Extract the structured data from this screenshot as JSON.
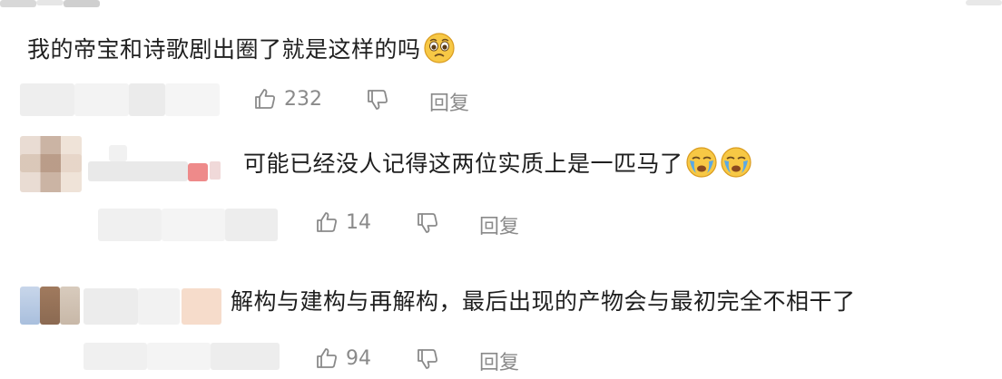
{
  "comments": [
    {
      "text": "我的帝宝和诗歌剧出圈了就是这样的吗",
      "emoji": [
        "pleading-face-icon"
      ],
      "likes": "232",
      "reply_label": "回复"
    },
    {
      "text": "可能已经没人记得这两位实质上是一匹马了",
      "emoji": [
        "crying-face-icon",
        "crying-face-icon"
      ],
      "likes": "14",
      "reply_label": "回复"
    },
    {
      "text": "解构与建构与再解构，最后出现的产物会与最初完全不相干了",
      "emoji": [],
      "likes": "94",
      "reply_label": "回复"
    }
  ],
  "colors": {
    "text": "#1f1f1f",
    "muted": "#8a8a8a",
    "emoji_yellow": "#f7c845",
    "tear_blue": "#5aa9e6"
  }
}
